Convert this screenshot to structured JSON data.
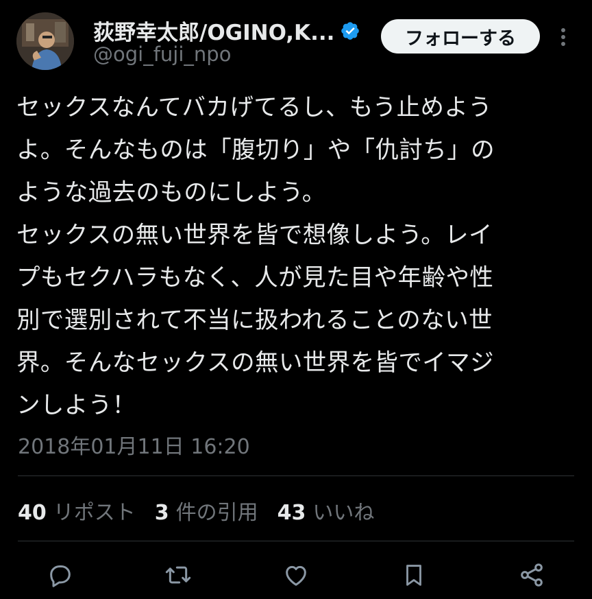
{
  "user": {
    "display_name": "荻野幸太郎/OGINO,K...",
    "handle": "@ogi_fuji_npo",
    "verified": true
  },
  "header": {
    "follow_label": "フォローする"
  },
  "tweet": {
    "lines": [
      "セックスなんてバカげてるし、もう止めよう",
      "よ。そんなものは「腹切り」や「仇討ち」の",
      "ような過去のものにしよう。",
      "セックスの無い世界を皆で想像しよう。レイ",
      "プもセクハラもなく、人が見た目や年齢や性",
      "別で選別されて不当に扱われることのない世",
      "界。そんなセックスの無い世界を皆でイマジ",
      "ンしよう！"
    ],
    "timestamp": "2018年01月11日 16:20"
  },
  "stats": {
    "reposts": {
      "count": "40",
      "label": "リポスト"
    },
    "quotes": {
      "count": "3",
      "label": "件の引用"
    },
    "likes": {
      "count": "43",
      "label": "いいね"
    }
  },
  "colors": {
    "background": "#000000",
    "text": "#e7e9ea",
    "muted": "#71767b",
    "divider": "#2f3336",
    "verified": "#1d9bf0",
    "follow_bg": "#eff3f4"
  },
  "icons": {
    "reply": "reply-icon",
    "repost": "repost-icon",
    "like": "like-icon",
    "bookmark": "bookmark-icon",
    "share": "share-icon"
  }
}
